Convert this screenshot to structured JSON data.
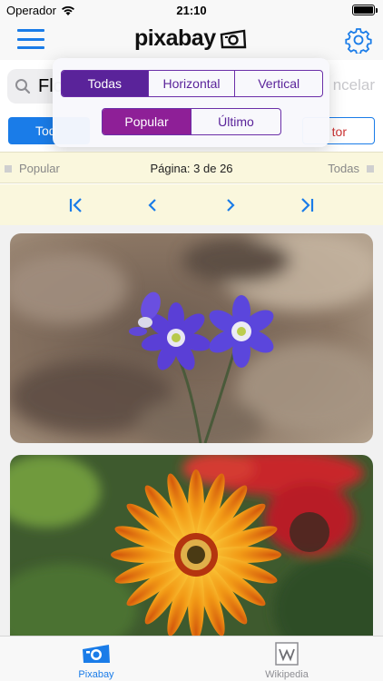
{
  "status_bar": {
    "carrier": "Operador",
    "time": "21:10"
  },
  "nav": {
    "logo_text": "pixabay"
  },
  "search": {
    "value": "Flo",
    "cancel_label": "ncelar"
  },
  "filters": {
    "category_label": "Tod",
    "color_label": "tor"
  },
  "orientation": {
    "options": [
      "Todas",
      "Horizontal",
      "Vertical"
    ],
    "selected": "Todas"
  },
  "sort": {
    "options": [
      "Popular",
      "Último"
    ],
    "selected": "Popular"
  },
  "pager": {
    "left_label": "Popular",
    "page_label": "Página: 3 de 26",
    "right_label": "Todas"
  },
  "photos": [
    {
      "subject": "purple hepatica flowers"
    },
    {
      "subject": "orange gerbera daisy"
    }
  ],
  "tabs": [
    {
      "label": "Pixabay",
      "icon": "camera-icon",
      "active": true
    },
    {
      "label": "Wikipedia",
      "icon": "wikipedia-icon",
      "active": false
    }
  ],
  "colors": {
    "accent": "#1a7ce8",
    "purple": "#5a239a",
    "magenta": "#8e1f97"
  }
}
